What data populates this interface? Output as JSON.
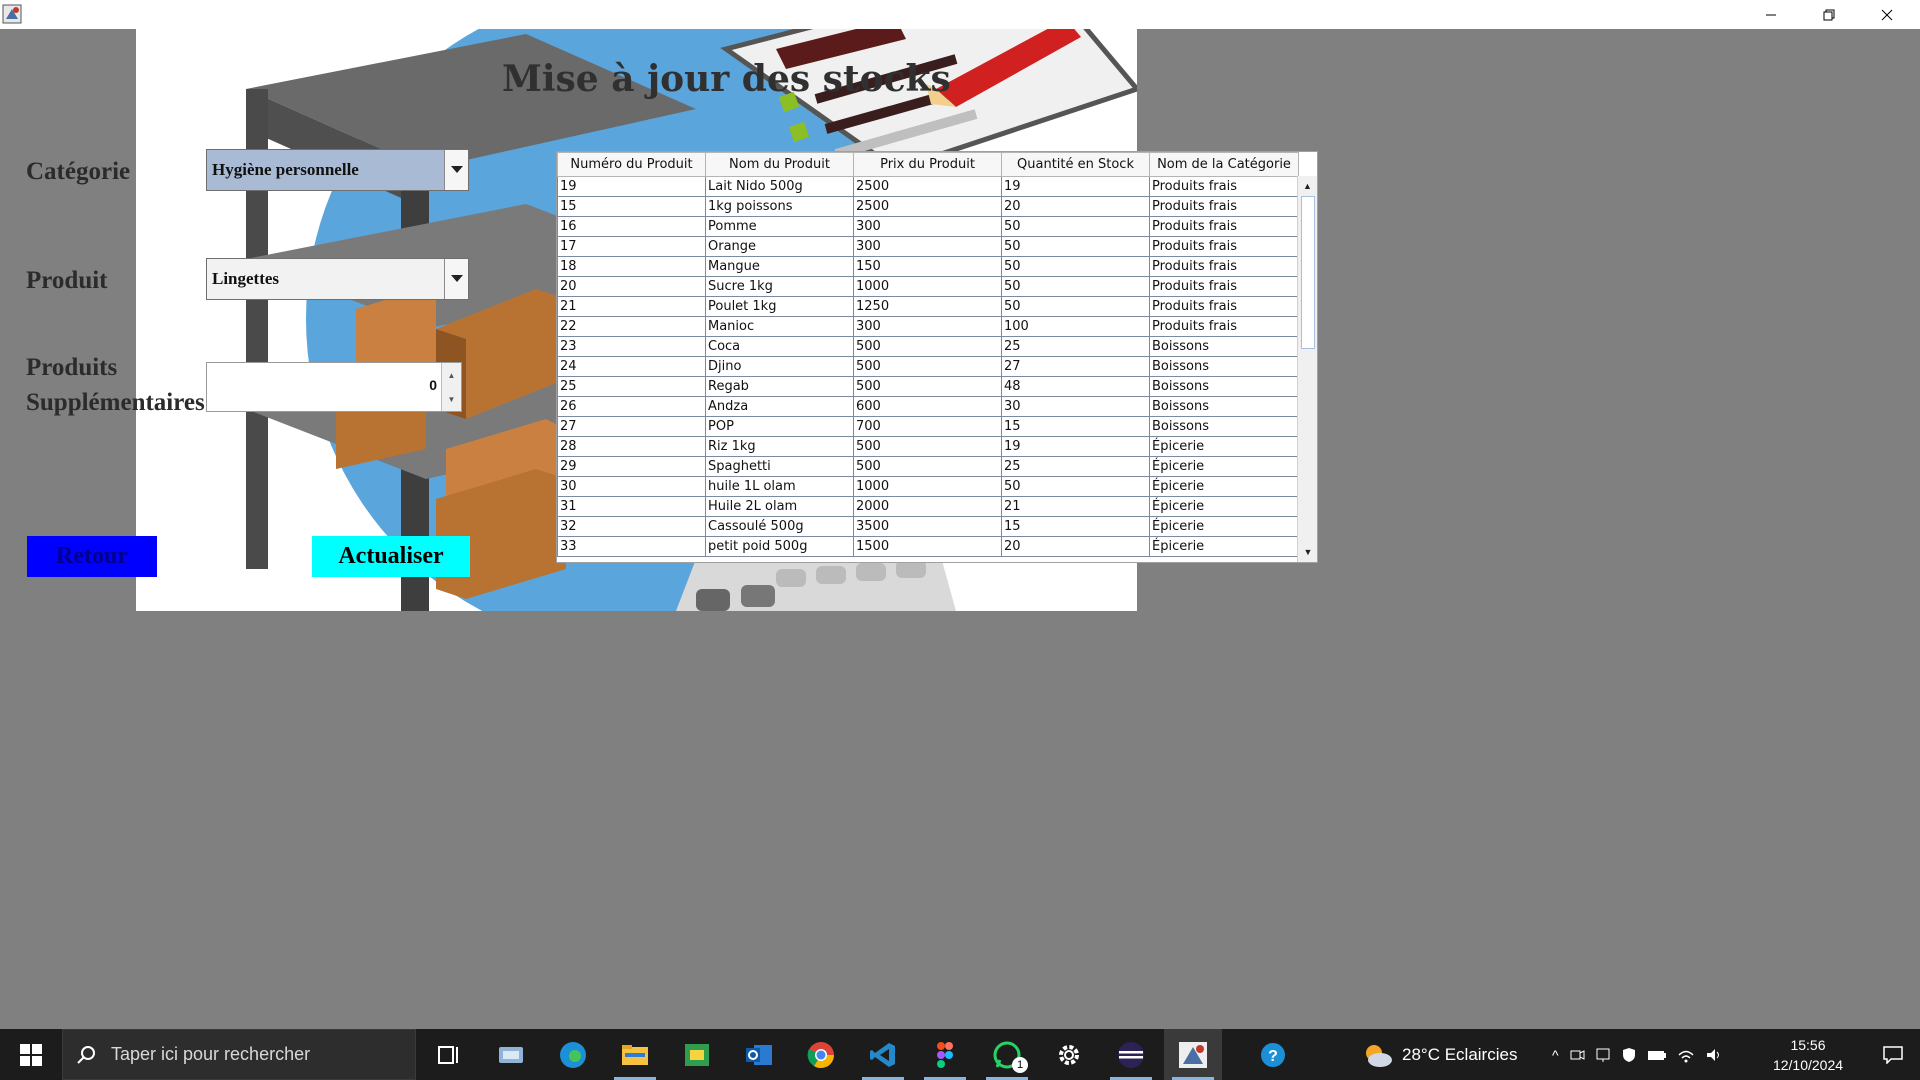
{
  "window": {
    "icon": "java-app-icon"
  },
  "page": {
    "title": "Mise à jour des stocks"
  },
  "form": {
    "category_label": "Catégorie",
    "category_value": "Hygiène personnelle",
    "product_label": "Produit",
    "product_value": "Lingettes",
    "extra_label_line1": "Produits",
    "extra_label_line2": "Supplémentaires",
    "extra_value": "0",
    "back_button": "Retour",
    "update_button": "Actualiser"
  },
  "table": {
    "columns": [
      "Numéro du Produit",
      "Nom du Produit",
      "Prix du Produit",
      "Quantité en Stock",
      "Nom de la Catégorie"
    ],
    "rows": [
      [
        "19",
        "Lait Nido 500g",
        "2500",
        "19",
        "Produits frais"
      ],
      [
        "15",
        "1kg poissons",
        "2500",
        "20",
        "Produits frais"
      ],
      [
        "16",
        "Pomme",
        "300",
        "50",
        "Produits frais"
      ],
      [
        "17",
        "Orange",
        "300",
        "50",
        "Produits frais"
      ],
      [
        "18",
        "Mangue",
        "150",
        "50",
        "Produits frais"
      ],
      [
        "20",
        "Sucre 1kg",
        "1000",
        "50",
        "Produits frais"
      ],
      [
        "21",
        "Poulet 1kg",
        "1250",
        "50",
        "Produits frais"
      ],
      [
        "22",
        "Manioc",
        "300",
        "100",
        "Produits frais"
      ],
      [
        "23",
        "Coca",
        "500",
        "25",
        "Boissons"
      ],
      [
        "24",
        "Djino",
        "500",
        "27",
        "Boissons"
      ],
      [
        "25",
        "Regab",
        "500",
        "48",
        "Boissons"
      ],
      [
        "26",
        "Andza",
        "600",
        "30",
        "Boissons"
      ],
      [
        "27",
        "POP",
        "700",
        "15",
        "Boissons"
      ],
      [
        "28",
        "Riz 1kg",
        "500",
        "19",
        "Épicerie"
      ],
      [
        "29",
        "Spaghetti",
        "500",
        "25",
        "Épicerie"
      ],
      [
        "30",
        "huile 1L olam",
        "1000",
        "50",
        "Épicerie"
      ],
      [
        "31",
        "Huile 2L olam",
        "2000",
        "21",
        "Épicerie"
      ],
      [
        "32",
        "Cassoulé 500g",
        "3500",
        "15",
        "Épicerie"
      ],
      [
        "33",
        "petit poid 500g",
        "1500",
        "20",
        "Épicerie"
      ]
    ]
  },
  "taskbar": {
    "search_placeholder": "Taper ici pour rechercher",
    "weather": "28°C  Eclaircies",
    "time": "15:56",
    "date": "12/10/2024",
    "whatsapp_badge": "1",
    "icons": [
      "task-view-icon",
      "explorer-app-icon",
      "edge-icon",
      "file-explorer-icon",
      "sheets-icon",
      "outlook-icon",
      "chrome-icon",
      "vscode-icon",
      "figma-icon",
      "whatsapp-icon",
      "settings-icon",
      "eclipse-icon",
      "java-app-icon",
      "help-icon"
    ]
  }
}
